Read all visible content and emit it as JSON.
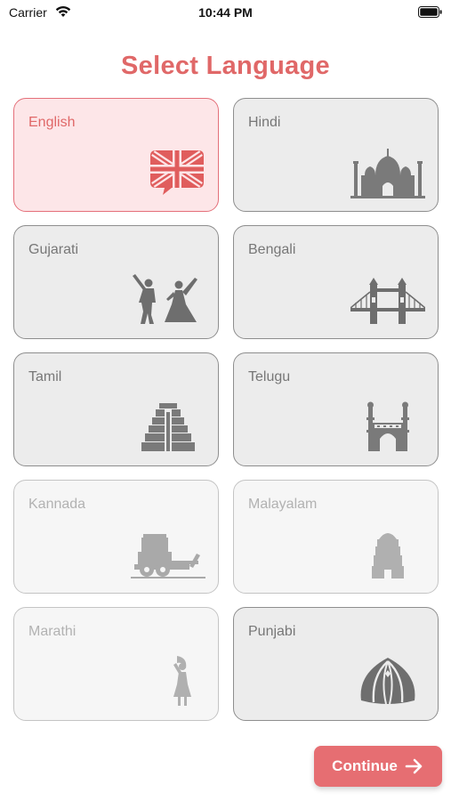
{
  "status_bar": {
    "carrier": "Carrier",
    "time": "10:44 PM"
  },
  "title": "Select Language",
  "languages": [
    {
      "label": "English",
      "icon": "uk-flag-bubble-icon",
      "state": "selected"
    },
    {
      "label": "Hindi",
      "icon": "taj-mahal-icon",
      "state": "normal"
    },
    {
      "label": "Gujarati",
      "icon": "garba-dancers-icon",
      "state": "normal"
    },
    {
      "label": "Bengali",
      "icon": "bridge-icon",
      "state": "normal"
    },
    {
      "label": "Tamil",
      "icon": "temple-gopuram-icon",
      "state": "normal"
    },
    {
      "label": "Telugu",
      "icon": "charminar-icon",
      "state": "normal"
    },
    {
      "label": "Kannada",
      "icon": "stone-chariot-icon",
      "state": "disabled"
    },
    {
      "label": "Malayalam",
      "icon": "kerala-temple-icon",
      "state": "disabled"
    },
    {
      "label": "Marathi",
      "icon": "lavani-dancer-icon",
      "state": "disabled"
    },
    {
      "label": "Punjabi",
      "icon": "turban-icon",
      "state": "normal"
    }
  ],
  "continue_label": "Continue",
  "colors": {
    "accent": "#e06868",
    "selected_bg": "#fde6e8",
    "card_bg": "#ececec",
    "disabled_bg": "#f6f6f6",
    "button": "#e66e72"
  }
}
